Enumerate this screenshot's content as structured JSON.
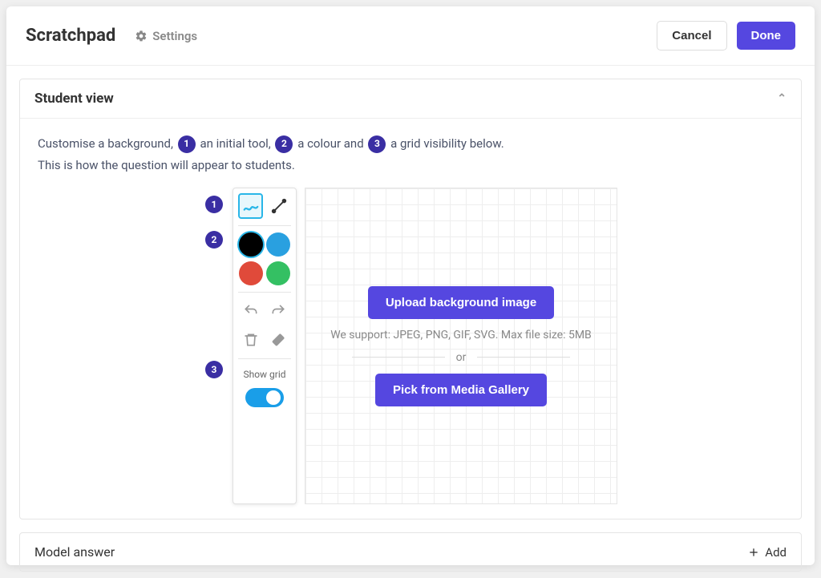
{
  "header": {
    "title": "Scratchpad",
    "settings": "Settings",
    "cancel": "Cancel",
    "done": "Done"
  },
  "student_view": {
    "heading": "Student view",
    "instruction_parts": {
      "p1": "Customise a background,",
      "b1": "1",
      "p2": "an initial tool,",
      "b2": "2",
      "p3": "a colour and",
      "b3": "3",
      "p4": "a grid visibility below.",
      "line2": "This is how the question will appear to students."
    },
    "badges": {
      "one": "1",
      "two": "2",
      "three": "3"
    },
    "toolbar": {
      "show_grid_label": "Show grid"
    },
    "canvas": {
      "upload": "Upload background image",
      "support": "We support: JPEG, PNG, GIF, SVG. Max file size: 5MB",
      "or": "or",
      "gallery": "Pick from Media Gallery"
    },
    "colors": {
      "black": "#000000",
      "blue": "#29a0e0",
      "red": "#e04a3a",
      "green": "#34c063"
    }
  },
  "model_answer": {
    "heading": "Model answer",
    "add": "Add"
  }
}
